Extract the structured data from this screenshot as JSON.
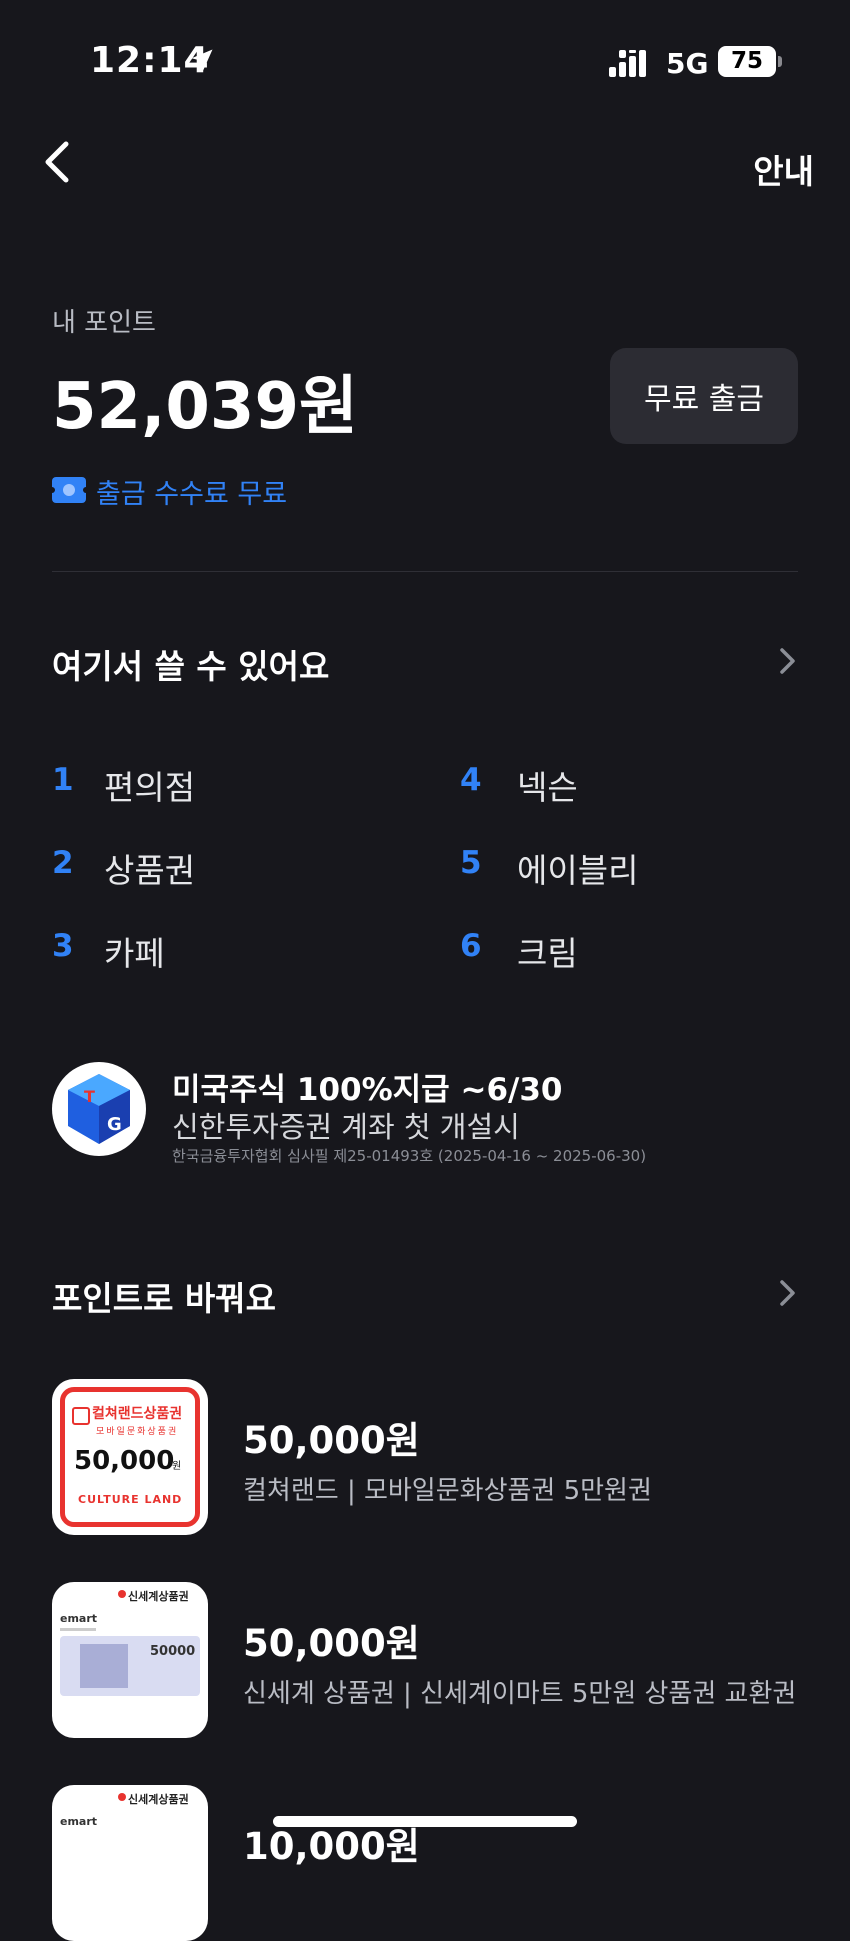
{
  "status_bar": {
    "time": "12:14",
    "network": "5G",
    "battery": "75"
  },
  "header": {
    "guide_label": "안내"
  },
  "points": {
    "label": "내 포인트",
    "value": "52,039원",
    "withdraw_button": "무료 출금",
    "fee_badge": "출금 수수료 무료"
  },
  "usage": {
    "title": "여기서 쓸 수 있어요",
    "items": [
      {
        "rank": "1",
        "name": "편의점"
      },
      {
        "rank": "2",
        "name": "상품권"
      },
      {
        "rank": "3",
        "name": "카페"
      },
      {
        "rank": "4",
        "name": "넥슨"
      },
      {
        "rank": "5",
        "name": "에이블리"
      },
      {
        "rank": "6",
        "name": "크림"
      }
    ]
  },
  "promo": {
    "title": "미국주식 100%지급 ~6/30",
    "subtitle": "신한투자증권 계좌 첫 개설시",
    "note": "한국금융투자협회 심사필 제25-01493호 (2025-04-16 ~ 2025-06-30)"
  },
  "exchange": {
    "title": "포인트로 바꿔요",
    "items": [
      {
        "price": "50,000원",
        "desc": "컬쳐랜드 | 모바일문화상품권 5만원권",
        "card_title": "컬쳐랜드상품권",
        "card_sub": "모바일문화상품권",
        "card_amount": "50,000",
        "card_unit": "원",
        "card_brand": "CULTURE LAND"
      },
      {
        "price": "50,000원",
        "desc": "신세계 상품권 | 신세계이마트 5만원 상품권 교환권",
        "card_title": "신세계상품권",
        "card_brand": "emart",
        "card_amount": "50000"
      },
      {
        "price": "10,000원",
        "desc": "",
        "card_title": "신세계상품권",
        "card_brand": "emart"
      }
    ]
  },
  "colors": {
    "background": "#17171c",
    "accent": "#3182f6",
    "button": "#2c2c33",
    "culture_red": "#e8332f"
  }
}
